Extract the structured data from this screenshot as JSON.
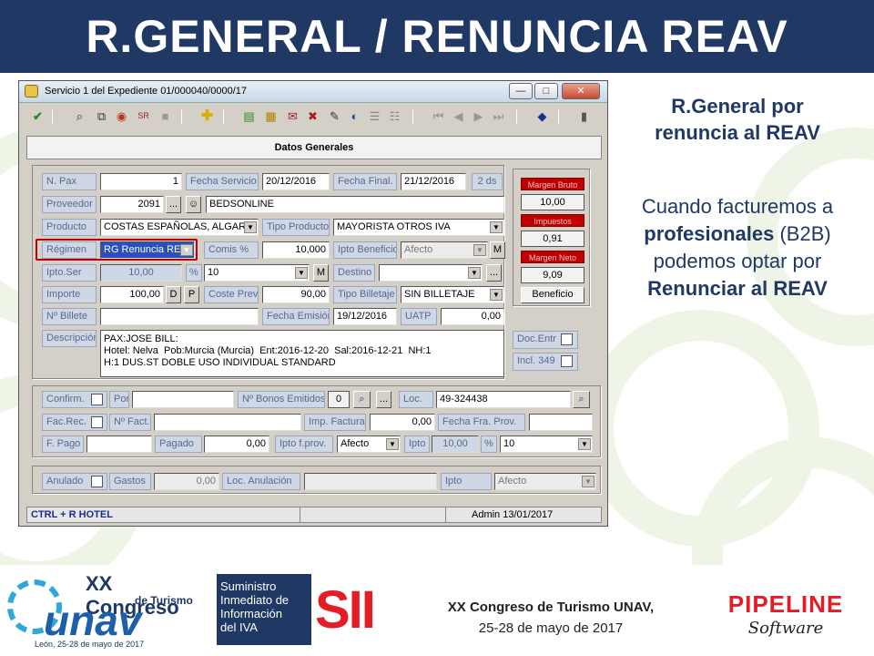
{
  "banner_title": "R.GENERAL / RENUNCIA REAV",
  "window": {
    "title": "Servicio 1 del Expediente 01/000040/0000/17",
    "min": "—",
    "max": "□",
    "close": "✕",
    "panel_title": "Datos Generales"
  },
  "toolbar_icons": [
    "check-icon",
    "search-doc-icon",
    "copy-icon",
    "globe-icon",
    "sr-icon",
    "cube-icon",
    "add-icon",
    "new-doc-icon",
    "edit-doc-icon",
    "doc-mail-icon",
    "doc-delete-icon",
    "pencil-icon",
    "toggle-icon",
    "list-icon",
    "list2-icon",
    "first-icon",
    "prev-icon",
    "next-icon",
    "last-icon",
    "book-icon",
    "exit-icon"
  ],
  "form": {
    "n_pax_label": "N. Pax",
    "n_pax": "1",
    "fecha_servicio_label": "Fecha Servicio",
    "fecha_servicio": "20/12/2016",
    "fecha_final_label": "Fecha Final.",
    "fecha_final": "21/12/2016",
    "dias": "2 ds",
    "proveedor_label": "Proveedor",
    "proveedor_code": "2091",
    "proveedor_name": "BEDSONLINE",
    "producto_label": "Producto",
    "producto": "COSTAS ESPAÑOLAS, ALGARV",
    "tipo_producto_label": "Tipo Producto",
    "tipo_producto": "MAYORISTA OTROS IVA",
    "regimen_label": "Régimen",
    "regimen": "RG Renuncia REA",
    "comis_label": "Comis %",
    "comis": "10,000",
    "ipto_beneficio_label": "Ipto Beneficio",
    "ipto_beneficio": "Afecto",
    "m_button": "M",
    "ipto_ser_label": "Ipto.Ser",
    "ipto_ser": "10,00",
    "pct": "%",
    "ipto_ser_sel": "10",
    "destino_label": "Destino",
    "destino": "",
    "importe_label": "Importe",
    "importe": "100,00",
    "d_btn": "D",
    "p_btn": "P",
    "coste_prev_label": "Coste Prev",
    "coste_prev": "90,00",
    "tipo_billetaje_label": "Tipo Billetaje",
    "tipo_billetaje": "SIN BILLETAJE",
    "n_billete_label": "Nº Billete",
    "n_billete": "",
    "fecha_emision_label": "Fecha Emisión",
    "fecha_emision": "19/12/2016",
    "uatp_label": "UATP",
    "uatp": "0,00",
    "descripcion_label": "Descripción",
    "descripcion": "PAX:JOSE BILL:\nHotel: Nelva  Pob:Murcia (Murcia)  Ent:2016-12-20  Sal:2016-12-21  NH:1\nH:1 DUS.ST DOBLE USO INDIVIDUAL STANDARD",
    "doc_entr_label": "Doc.Entr",
    "incl_349_label": "Incl. 349",
    "ellipsis": "..."
  },
  "margins": {
    "margen_bruto_label": "Margen Bruto",
    "margen_bruto": "10,00",
    "impuestos_label": "Impuestos",
    "impuestos": "0,91",
    "margen_neto_label": "Margen Neto",
    "margen_neto": "9,09",
    "beneficio_button": "Beneficio"
  },
  "lower": {
    "confirm_label": "Confirm.",
    "por_label": "Por",
    "por": "",
    "bonos_label": "Nº Bonos Emitidos",
    "bonos": "0",
    "loc_label": "Loc.",
    "loc": "49-324438",
    "fac_rec_label": "Fac.Rec.",
    "n_fact_label": "Nº Fact.",
    "n_fact": "",
    "imp_factura_label": "Imp. Factura",
    "imp_factura": "0,00",
    "fecha_fra_label": "Fecha Fra. Prov.",
    "fecha_fra": "",
    "f_pago_label": "F. Pago",
    "f_pago": "",
    "pagado_label": "Pagado",
    "pagado": "0,00",
    "ipto_fprov_label": "Ipto f.prov.",
    "ipto_fprov": "Afecto",
    "ipto_label": "Ipto",
    "ipto": "10,00",
    "pct": "%",
    "ipto_sel": "10",
    "anulado_label": "Anulado",
    "gastos_label": "Gastos",
    "gastos": "0,00",
    "loc_anulacion_label": "Loc. Anulación",
    "loc_anulacion": "",
    "ipto2_label": "Ipto",
    "ipto2": "Afecto"
  },
  "statusbar": {
    "left": "CTRL + R HOTEL",
    "right": "Admin 13/01/2017"
  },
  "side": {
    "heading_line1": "R.General por",
    "heading_line2": "renuncia al REAV",
    "p1": "Cuando facturemos a",
    "p2_bold": "profesionales",
    "p2_rest": " (B2B)",
    "p3": "podemos optar por",
    "p4": "Renunciar al REAV"
  },
  "footer": {
    "unav_big": "XX Congreso",
    "unav_small": "de Turismo",
    "unav_word": "unav",
    "unav_city": "León, 25-28 de mayo de 2017",
    "sii_lines": [
      "Suministro",
      "Inmediato de",
      "Información",
      "del IVA"
    ],
    "sii_logo": "SII",
    "congress_line1": "XX Congreso  de Turismo  UNAV,",
    "congress_line2": "25-28 de mayo de 2017",
    "pipeline": "PIPELINE",
    "software": "Software"
  },
  "colors": {
    "banner": "#1f3864",
    "accent_red": "#c00000",
    "label_bg": "#cfd6e4"
  }
}
